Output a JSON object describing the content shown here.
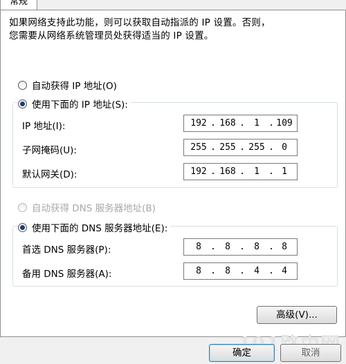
{
  "tab": {
    "label": "常规"
  },
  "description": [
    "如果网络支持此功能，则可以获取自动指派的 IP 设置。否则，",
    "您需要从网络系统管理员处获得适当的 IP 设置。"
  ],
  "ip_section": {
    "auto_label": "自动获得 IP 地址(O)",
    "manual_label": "使用下面的 IP 地址(S):",
    "selected": "manual",
    "fields": [
      {
        "label": "IP 地址(I):",
        "octets": [
          "192",
          "168",
          "1",
          "109"
        ]
      },
      {
        "label": "子网掩码(U):",
        "octets": [
          "255",
          "255",
          "255",
          "0"
        ]
      },
      {
        "label": "默认网关(D):",
        "octets": [
          "192",
          "168",
          "1",
          "1"
        ]
      }
    ]
  },
  "dns_section": {
    "auto_label": "自动获得 DNS 服务器地址(B)",
    "manual_label": "使用下面的 DNS 服务器地址(E):",
    "selected": "manual",
    "fields": [
      {
        "label": "首选 DNS 服务器(P):",
        "octets": [
          "8",
          "8",
          "8",
          "8"
        ]
      },
      {
        "label": "备用 DNS 服务器(A):",
        "octets": [
          "8",
          "8",
          "4",
          "4"
        ]
      }
    ]
  },
  "buttons": {
    "advanced": "高级(V)...",
    "ok": "确定",
    "cancel": "取消"
  },
  "watermark": "191路由网"
}
